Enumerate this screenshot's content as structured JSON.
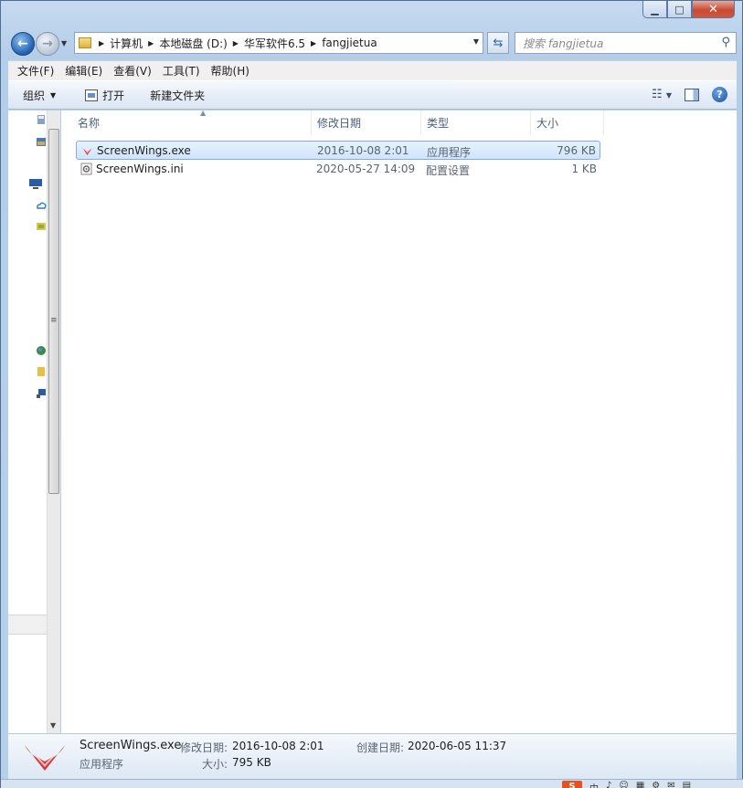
{
  "window": {
    "min_glyph": "▁",
    "max_glyph": "□",
    "close_glyph": "✕"
  },
  "nav": {
    "back_glyph": "←",
    "forward_glyph": "→",
    "breadcrumbs": [
      "计算机",
      "本地磁盘 (D:)",
      "华军软件6.5",
      "fangjietua"
    ],
    "search_placeholder": "搜索 fangjietua"
  },
  "menu": [
    "文件(F)",
    "编辑(E)",
    "查看(V)",
    "工具(T)",
    "帮助(H)"
  ],
  "commands": {
    "organize": "组织",
    "open": "打开",
    "new_folder": "新建文件夹"
  },
  "columns": {
    "name": "名称",
    "modified": "修改日期",
    "type": "类型",
    "size": "大小"
  },
  "files": [
    {
      "name": "ScreenWings.exe",
      "modified": "2016-10-08 2:01",
      "type": "应用程序",
      "size": "796 KB",
      "selected": true,
      "icon": "app-wings-icon"
    },
    {
      "name": "ScreenWings.ini",
      "modified": "2020-05-27 14:09",
      "type": "配置设置",
      "size": "1 KB",
      "selected": false,
      "icon": "config-file-icon"
    }
  ],
  "details": {
    "name": "ScreenWings.exe",
    "kind": "应用程序",
    "modified_label": "修改日期:",
    "modified_value": "2016-10-08 2:01",
    "size_label": "大小:",
    "size_value": "795 KB",
    "created_label": "创建日期:",
    "created_value": "2020-06-05 11:37"
  },
  "taskbar": {
    "ime_label": "S",
    "tray": [
      "中",
      "♪",
      "☺",
      "▦",
      "⚙",
      "✉",
      "▤"
    ]
  },
  "colors": {
    "selection_border": "#84acdd",
    "wings_red": "#d23a3a",
    "ime_orange": "#e8501f"
  }
}
